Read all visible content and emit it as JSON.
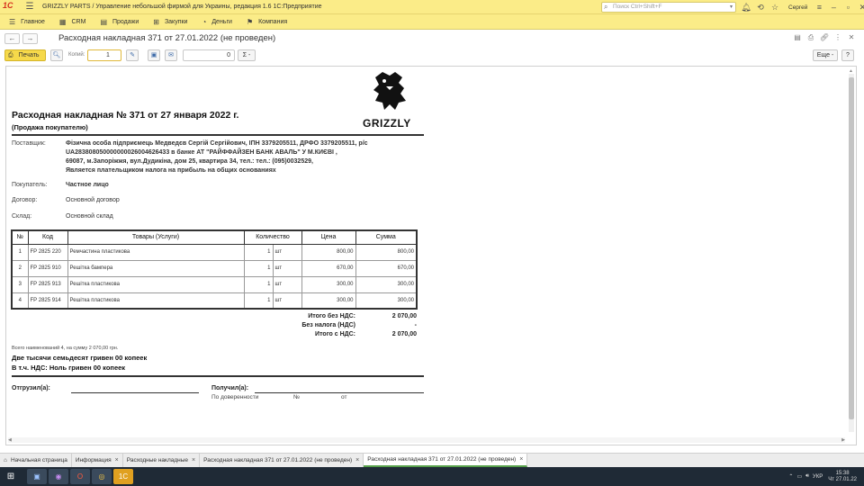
{
  "titlebar": {
    "logo": "1С",
    "title": "GRIZZLY PARTS / Управление небольшой фирмой для Украины, редакция 1.6 1С:Предприятие",
    "search_placeholder": "Поиск Ctrl+Shift+F",
    "user": "Сергей"
  },
  "menu": {
    "items": [
      {
        "label": "Главное",
        "icon": "grid-icon"
      },
      {
        "label": "CRM",
        "icon": "crm-icon"
      },
      {
        "label": "Продажи",
        "icon": "sales-icon"
      },
      {
        "label": "Закупки",
        "icon": "purchase-icon"
      },
      {
        "label": "Деньги",
        "icon": "money-icon"
      },
      {
        "label": "Компания",
        "icon": "flag-icon"
      }
    ]
  },
  "doc_header": {
    "title": "Расходная накладная 371 от 27.01.2022 (не проведен)"
  },
  "toolbar": {
    "print_label": "Печать",
    "copies_label": "Копий:",
    "copies_value": "1",
    "number_value": "0",
    "sum_label": "Σ -",
    "more_label": "Еще -",
    "help_label": "?"
  },
  "document": {
    "logo_text": "GRIZZLY",
    "heading": "Расходная накладная № 371 от 27 января 2022 г.",
    "subheading": "(Продажа покупателю)",
    "supplier_label": "Поставщик:",
    "supplier_line1": "Фізична особа підприємець Медведєв Сергій Сергійович,  ІПН 3379205511,  ДРФО 3379205511, р/с",
    "supplier_line2": "UA283808050000000026004626433 в банке АТ \"РАЙФФАЙЗЕН БАНК АВАЛЬ\" У М.КИЄВІ           ,",
    "supplier_line3": "69087, м.Запоріжжя, вул.Дудикіна, дом 25, квартира 34,  тел.: тел.: (095)0032529,",
    "supplier_line4": "Является плательщиком налога на прибыль на общих основаниях",
    "buyer_label": "Покупатель:",
    "buyer_value": "Частное лицо",
    "contract_label": "Договор:",
    "contract_value": "Основной договор",
    "warehouse_label": "Склад:",
    "warehouse_value": "Основной склад",
    "table_headers": [
      "№",
      "Код",
      "Товары (Услуги)",
      "Количество",
      "Цена",
      "Сумма"
    ],
    "rows": [
      {
        "n": "1",
        "code": "FP 2825 220",
        "name": "Ремчастина пластикова",
        "qty": "1",
        "unit": "шт",
        "price": "800,00",
        "sum": "800,00"
      },
      {
        "n": "2",
        "code": "FP 2825 910",
        "name": "Решітка бампера",
        "qty": "1",
        "unit": "шт",
        "price": "670,00",
        "sum": "670,00"
      },
      {
        "n": "3",
        "code": "FP 2825 913",
        "name": "Решітка пластикова",
        "qty": "1",
        "unit": "шт",
        "price": "300,00",
        "sum": "300,00"
      },
      {
        "n": "4",
        "code": "FP 2825 914",
        "name": "Решітка пластикова",
        "qty": "1",
        "unit": "шт",
        "price": "300,00",
        "sum": "300,00"
      }
    ],
    "total_no_vat_label": "Итого без НДС:",
    "total_no_vat_value": "2 070,00",
    "no_tax_label": "Без налога (НДС)",
    "no_tax_value": "-",
    "total_vat_label": "Итого с НДС:",
    "total_vat_value": "2 070,00",
    "items_summary": "Всего наименований 4, на сумму 2 070,00 грн.",
    "amount_words": "Две тысячи семьдесят гривен 00 копеек",
    "vat_words": "В т.ч. НДС: Ноль гривен 00 копеек",
    "shipped_label": "Отгрузил(а):",
    "received_label": "Получил(а):",
    "proxy_label": "По доверенности",
    "proxy_no": "№",
    "proxy_from": "от"
  },
  "tabs": [
    {
      "label": "Начальная страница",
      "closable": false
    },
    {
      "label": "Информация",
      "closable": true
    },
    {
      "label": "Расходные накладные",
      "closable": true
    },
    {
      "label": "Расходная накладная 371 от 27.01.2022 (не проведен)",
      "closable": true
    },
    {
      "label": "Расходная накладная 371 от 27.01.2022 (не проведен)",
      "closable": true
    }
  ],
  "tray": {
    "lang": "УКР",
    "time": "15:38",
    "date": "Чт 27.01.22"
  },
  "colors": {
    "titlebar": "#fbec88",
    "print_button": "#f6d94a",
    "taskbar": "#1f2a36",
    "active_tab_accent": "#57a04a"
  }
}
